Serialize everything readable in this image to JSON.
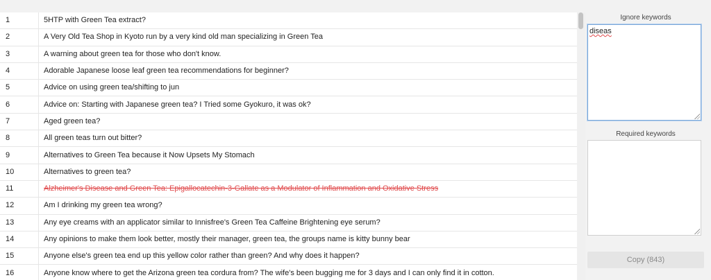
{
  "results": {
    "rows": [
      {
        "num": "1",
        "title": "5HTP with Green Tea extract?",
        "ignored": false
      },
      {
        "num": "2",
        "title": "A Very Old Tea Shop in Kyoto run by a very kind old man specializing in Green Tea",
        "ignored": false
      },
      {
        "num": "3",
        "title": "A warning about green tea for those who don't know.",
        "ignored": false
      },
      {
        "num": "4",
        "title": "Adorable Japanese loose leaf green tea recommendations for beginner?",
        "ignored": false
      },
      {
        "num": "5",
        "title": "Advice on using green tea/shifting to jun",
        "ignored": false
      },
      {
        "num": "6",
        "title": "Advice on: Starting with Japanese green tea? I Tried some Gyokuro, it was ok?",
        "ignored": false
      },
      {
        "num": "7",
        "title": "Aged green tea?",
        "ignored": false
      },
      {
        "num": "8",
        "title": "All green teas turn out bitter?",
        "ignored": false
      },
      {
        "num": "9",
        "title": "Alternatives to Green Tea because it Now Upsets My Stomach",
        "ignored": false
      },
      {
        "num": "10",
        "title": "Alternatives to green tea?",
        "ignored": false
      },
      {
        "num": "11",
        "title": "Alzheimer's Disease and Green Tea: Epigallocatechin-3-Gallate as a Modulator of Inflammation and Oxidative Stress",
        "ignored": true
      },
      {
        "num": "12",
        "title": "Am I drinking my green tea wrong?",
        "ignored": false
      },
      {
        "num": "13",
        "title": "Any eye creams with an applicator similar to Innisfree's Green Tea Caffeine Brightening eye serum?",
        "ignored": false
      },
      {
        "num": "14",
        "title": "Any opinions to make them look better, mostly their manager, green tea, the groups name is kitty bunny bear",
        "ignored": false
      },
      {
        "num": "15",
        "title": "Anyone else's green tea end up this yellow color rather than green? And why does it happen?",
        "ignored": false
      },
      {
        "num": "16",
        "title": "Anyone know where to get the Arizona green tea cordura from? The wife's been bugging me for 3 days and I can only find it in cotton.",
        "ignored": false
      }
    ]
  },
  "sidebar": {
    "ignore_label": "Ignore keywords",
    "ignore_value": "diseas",
    "required_label": "Required keywords",
    "required_value": "",
    "copy_label": "Copy (843)"
  },
  "colors": {
    "ignored_text": "#e0484a",
    "focus_border": "#7aa7d8"
  }
}
